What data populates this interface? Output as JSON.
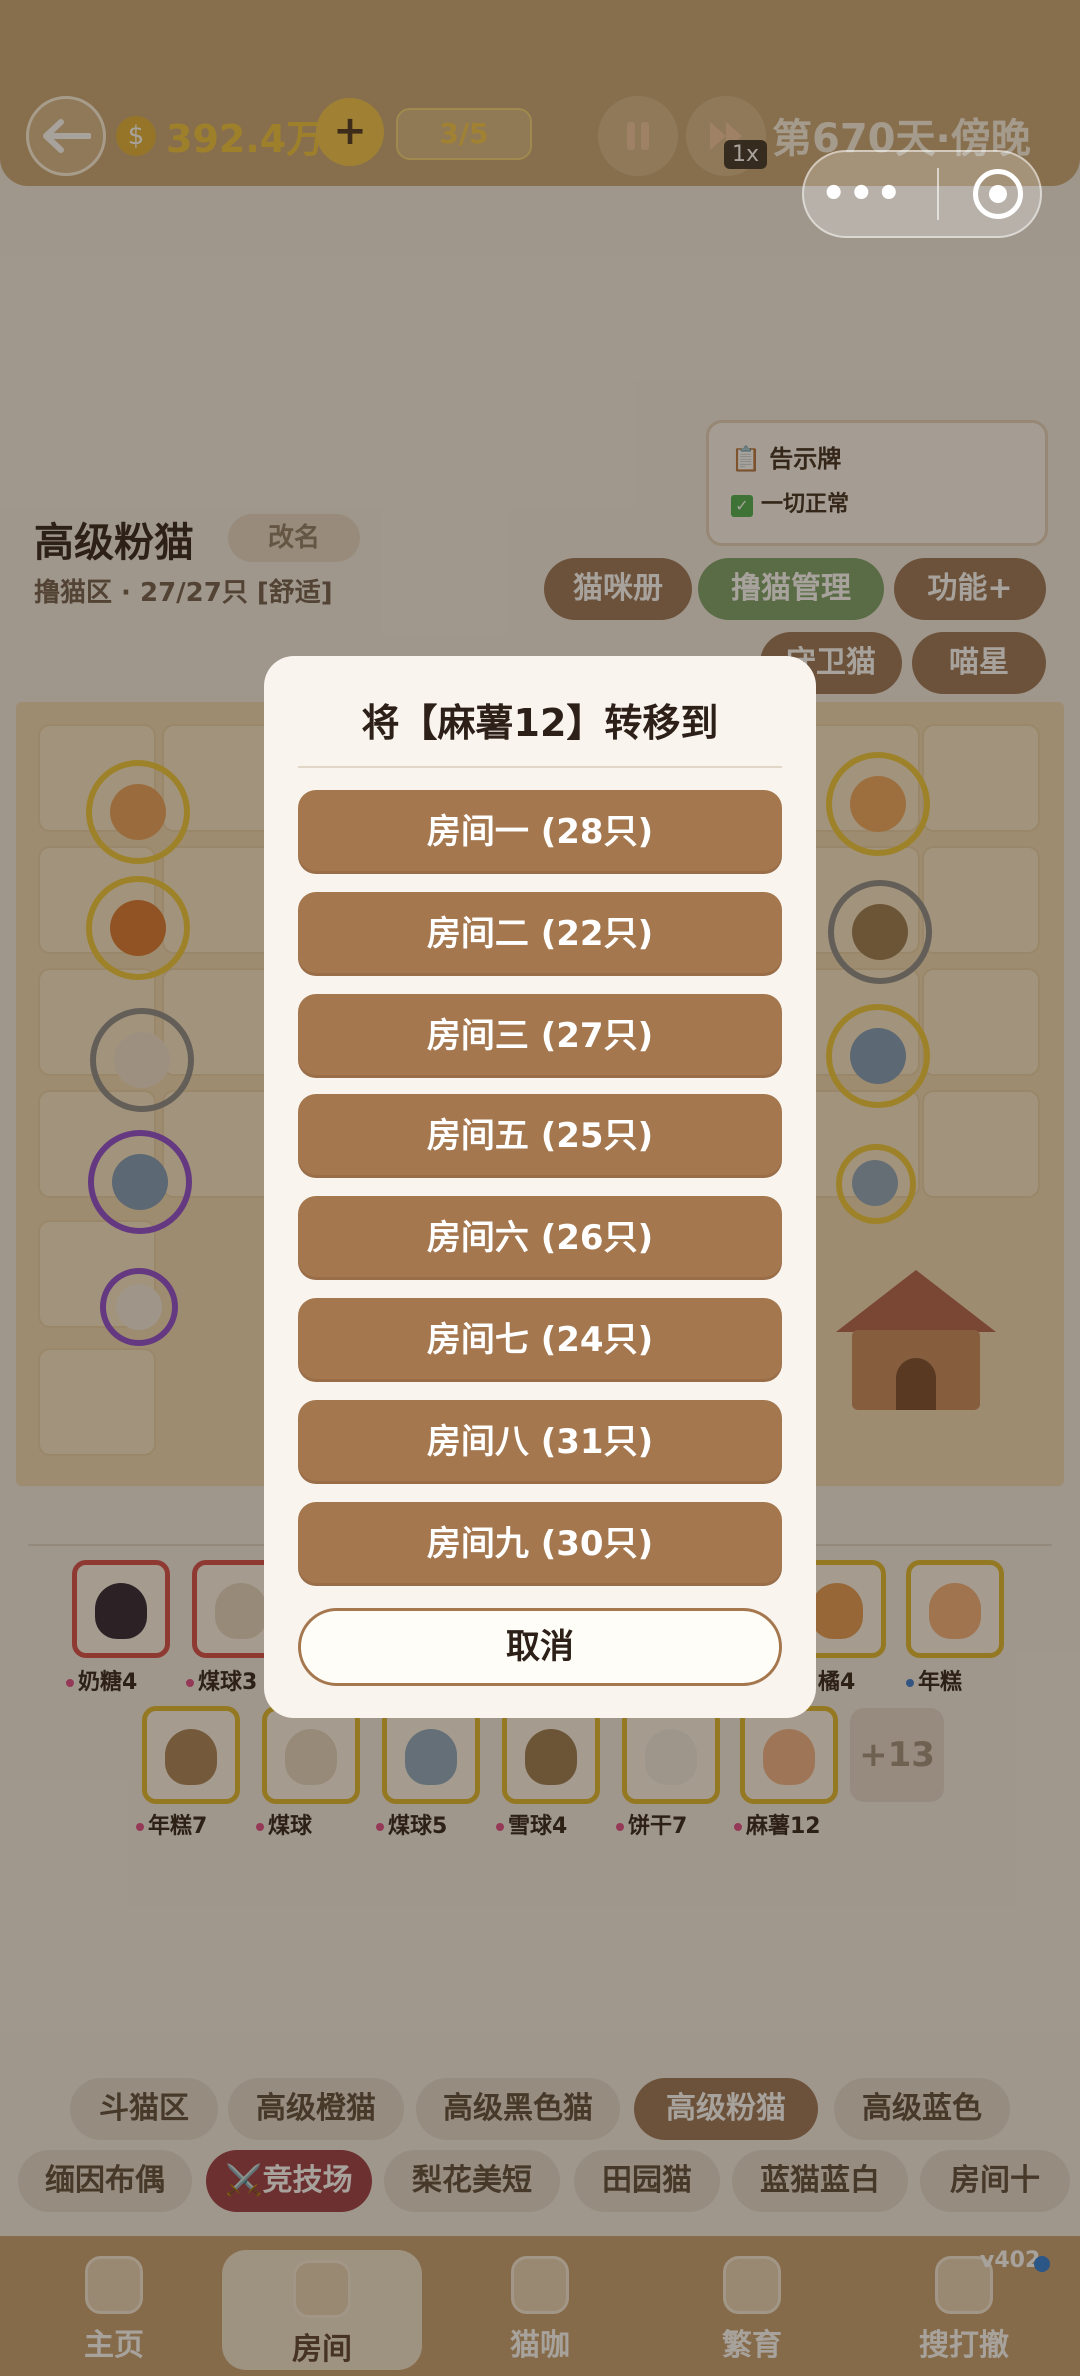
{
  "header": {
    "money": "392.4万",
    "cat_count": "3/5",
    "speed": "1x",
    "day_text": "第670天·傍晚"
  },
  "notice": {
    "title": "告示牌",
    "status": "一切正常"
  },
  "room": {
    "name": "高级粉猫",
    "rename_label": "改名",
    "subtitle": "撸猫区 · 27/27只 [舒适]"
  },
  "action_buttons": {
    "album": "猫咪册",
    "manage": "撸猫管理",
    "functions": "功能+",
    "guard": "守卫猫",
    "star": "喵星"
  },
  "cats_row1": [
    "奶糖4",
    "煤球3",
    "橘4",
    "年糕"
  ],
  "cats_row2": [
    "年糕7",
    "煤球",
    "煤球5",
    "雪球4",
    "饼干7",
    "麻薯12"
  ],
  "more_count": "+13",
  "dialog": {
    "title": "将【麻薯12】转移到",
    "rooms": [
      "房间一 (28只)",
      "房间二 (22只)",
      "房间三 (27只)",
      "房间五 (25只)",
      "房间六 (26只)",
      "房间七 (24只)",
      "房间八 (31只)",
      "房间九 (30只)"
    ],
    "cancel": "取消"
  },
  "room_tags_row1": [
    "斗猫区",
    "高级橙猫",
    "高级黑色猫",
    "高级粉猫",
    "高级蓝色"
  ],
  "room_tags_row2": [
    "缅因布偶",
    "⚔️竞技场",
    "梨花美短",
    "田园猫",
    "蓝猫蓝白",
    "房间十"
  ],
  "nav": [
    "主页",
    "房间",
    "猫咖",
    "繁育",
    "搜打撤"
  ],
  "version": "v402",
  "colors": {
    "dialog_button": "#a5774e",
    "active_tag": "#9a7658",
    "arena_tag": "#9b3b46",
    "manage_green": "#7aa36a"
  }
}
